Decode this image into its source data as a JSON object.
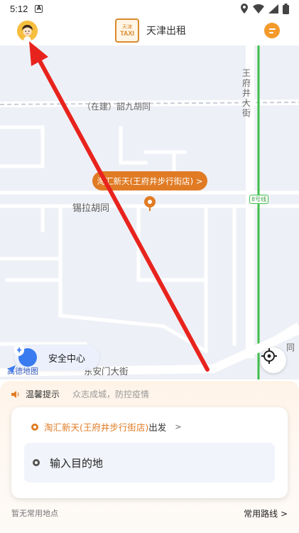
{
  "status_bar": {
    "time": "5:12",
    "notification_icon_letter": "A"
  },
  "header": {
    "title": "天津出租",
    "logo_top_text": "天津",
    "logo_main_text": "TAXI"
  },
  "map": {
    "street_labels": {
      "hutong_under_construction": "（在建）韶九胡同",
      "wangfujing": "王府井大街",
      "xila_hutong": "锡拉胡同",
      "dong_anmen": "东安门大街",
      "metro_line": "8号线",
      "edge_fragment": "同"
    },
    "poi_label": "淘汇新天(王府井步行街店) >",
    "safety_center_label": "安全中心",
    "brand_label": "高德地图"
  },
  "sheet": {
    "tip_title": "温馨提示",
    "tip_text": "众志成城，防控疫情",
    "origin_place": "淘汇新天(王府井步行街店)",
    "origin_suffix": "出发",
    "origin_chevron": ">",
    "destination_placeholder": "输入目的地",
    "no_frequent_places": "暂无常用地点",
    "common_routes": "常用路线 >"
  },
  "colors": {
    "accent_orange": "#e07b24",
    "message_button": "#f39a2b",
    "safety_blue": "#3a7cf0",
    "annotation_arrow": "#e8231d",
    "metro_line_green": "#3fbf4a"
  }
}
